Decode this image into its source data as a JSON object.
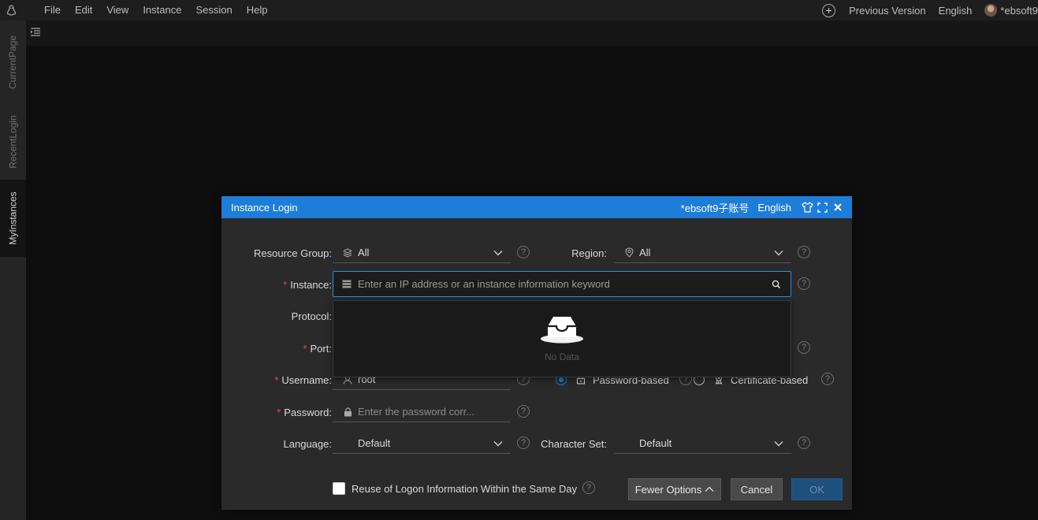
{
  "menubar": {
    "items": [
      "File",
      "Edit",
      "View",
      "Instance",
      "Session",
      "Help"
    ],
    "previous_version": "Previous Version",
    "language": "English",
    "user": "*ebsoft9"
  },
  "sidebar": {
    "tabs": [
      {
        "label": "CurrentPage",
        "active": false
      },
      {
        "label": "RecentLogin",
        "active": false
      },
      {
        "label": "MyInstances",
        "active": true
      }
    ]
  },
  "modal": {
    "title": "Instance Login",
    "user": "*ebsoft9子账号",
    "language": "English",
    "resource_group": {
      "label": "Resource Group",
      "value": "All"
    },
    "region": {
      "label": "Region",
      "value": "All"
    },
    "instance": {
      "label": "Instance",
      "placeholder": "Enter an IP address or an instance information keyword"
    },
    "dropdown_empty": "No Data",
    "protocol": {
      "label": "Protocol"
    },
    "port": {
      "label": "Port"
    },
    "username": {
      "label": "Username",
      "value": "root"
    },
    "auth": {
      "option1": "Password-based",
      "option2": "Certificate-based",
      "selected": "Password-based"
    },
    "password": {
      "label": "Password",
      "placeholder": "Enter the password corr..."
    },
    "language_field": {
      "label": "Language",
      "value": "Default"
    },
    "charset": {
      "label": "Character Set",
      "value": "Default"
    },
    "reuse_label": "Reuse of Logon Information Within the Same Day",
    "buttons": {
      "fewer": "Fewer Options",
      "cancel": "Cancel",
      "ok": "OK"
    }
  },
  "colors": {
    "accent": "#1e7dd8",
    "required": "#e84a4a"
  }
}
